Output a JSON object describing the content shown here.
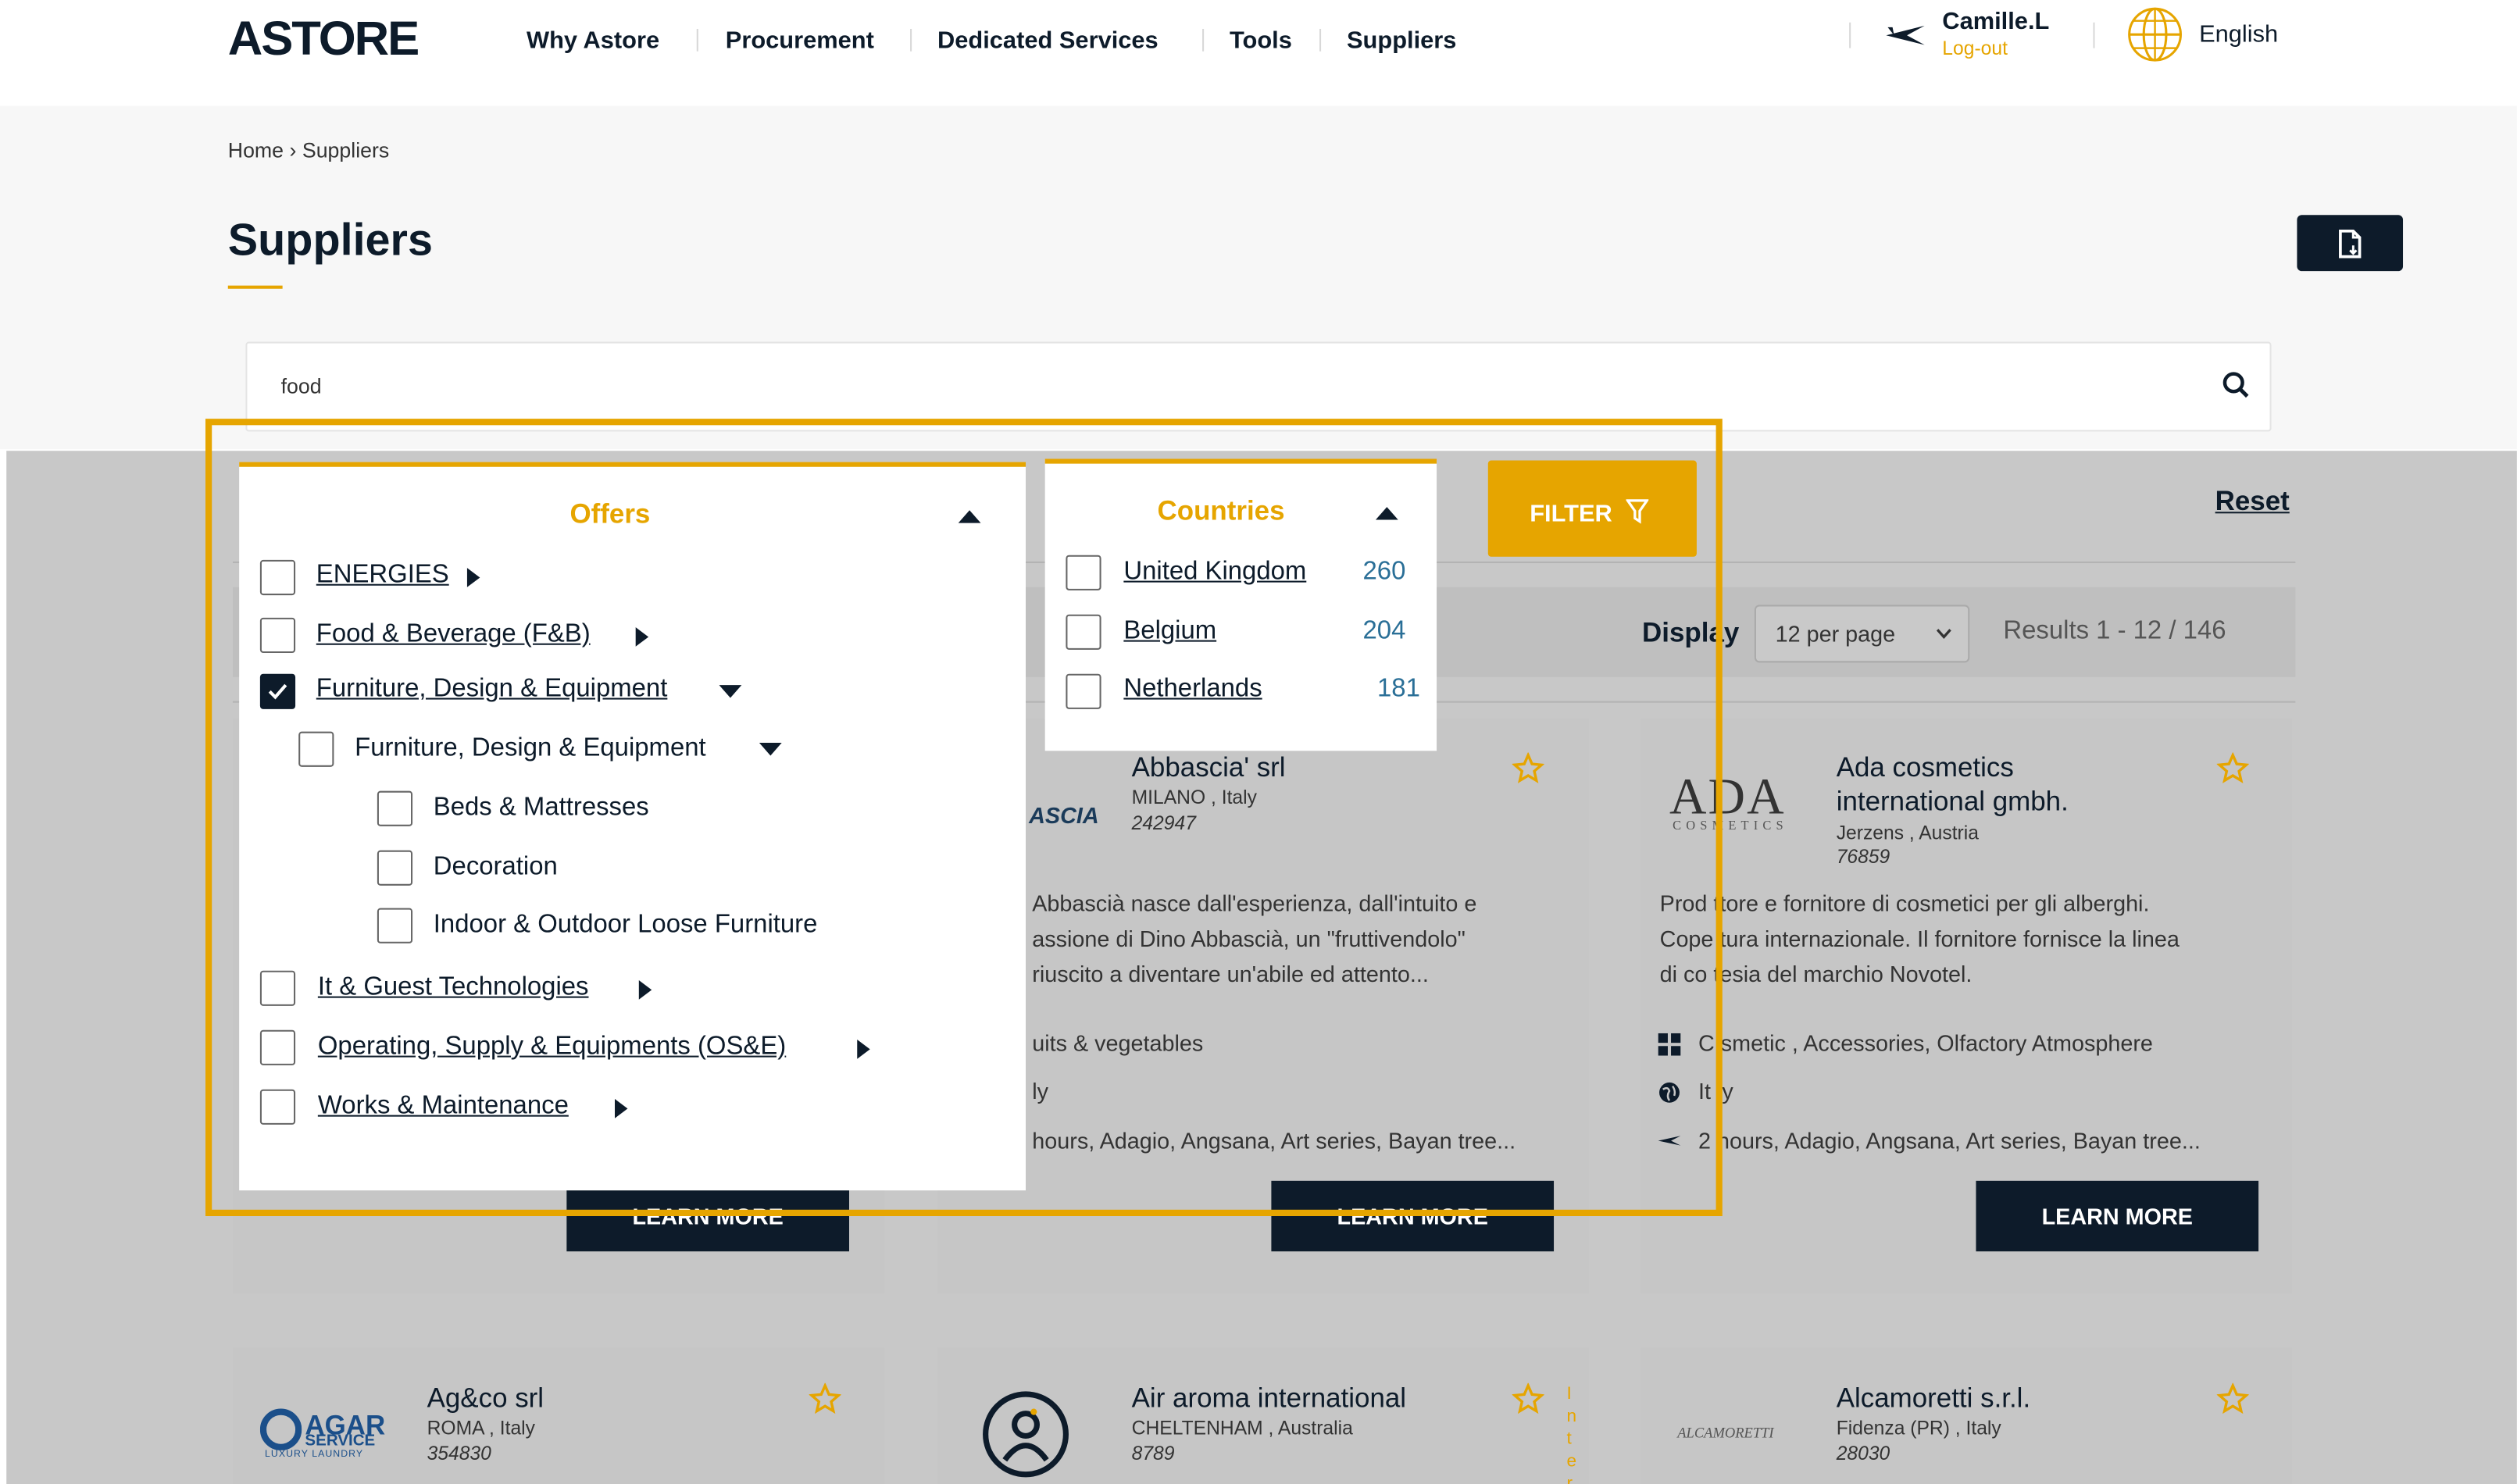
{
  "header": {
    "logo": "ASTORE",
    "nav": [
      "Why Astore",
      "Procurement",
      "Dedicated Services",
      "Tools",
      "Suppliers"
    ],
    "user_name": "Camille.L",
    "logout": "Log-out",
    "language": "English"
  },
  "breadcrumb": {
    "home": "Home",
    "sep": "›",
    "current": "Suppliers"
  },
  "page_title": "Suppliers",
  "search": {
    "value": "food"
  },
  "filters": {
    "offers": {
      "title": "Offers",
      "items": [
        {
          "label": "ENERGIES",
          "checked": false
        },
        {
          "label": "Food & Beverage (F&B)",
          "checked": false
        },
        {
          "label": "Furniture, Design & Equipment",
          "checked": true
        },
        {
          "label": "Furniture, Design & Equipment",
          "checked": false
        },
        {
          "label": "Beds & Mattresses",
          "checked": false
        },
        {
          "label": "Decoration",
          "checked": false
        },
        {
          "label": "Indoor & Outdoor Loose Furniture",
          "checked": false
        },
        {
          "label": "It & Guest Technologies",
          "checked": false
        },
        {
          "label": "Operating, Supply & Equipments (OS&E)",
          "checked": false
        },
        {
          "label": "Works & Maintenance",
          "checked": false
        }
      ]
    },
    "countries": {
      "title": "Countries",
      "items": [
        {
          "label": "United Kingdom",
          "count": "260"
        },
        {
          "label": "Belgium",
          "count": "204"
        },
        {
          "label": "Netherlands",
          "count": "181"
        }
      ]
    },
    "filter_button": "FILTER",
    "reset": "Reset"
  },
  "results_bar": {
    "display_label": "Display",
    "per_page": "12 per page",
    "results": "Results 1 - 12 / 146"
  },
  "cards": [
    {
      "name": "Abbascia' srl",
      "location": "MILANO , Italy",
      "id": "242947",
      "logo_text": "ASCIA",
      "description": [
        "Abbascià nasce dall'esperienza, dall'intuito e",
        "assione di Dino Abbascià, un \"fruttivendolo\"",
        "riuscito a diventare un'abile ed attento..."
      ],
      "category": "uits & vegetables",
      "country": "ly",
      "brands": "hours, Adagio, Angsana, Art series, Bayan tree...",
      "button": "LEARN MORE"
    },
    {
      "name": "Ada cosmetics",
      "name2": "international gmbh.",
      "location": "Jerzens , Austria",
      "id": "76859",
      "logo_text": "ADA",
      "logo_sub": "COSMETICS",
      "description": [
        "Prod ttore e fornitore di cosmetici per gli alberghi.",
        "Cope tura internazionale. Il fornitore fornisce la linea",
        "di co tesia del marchio Novotel."
      ],
      "category": "C smetic , Accessories, Olfactory Atmosphere",
      "country": "It ly",
      "brands": "2  hours, Adagio, Angsana, Art series, Bayan tree...",
      "button": "LEARN MORE"
    },
    {
      "name": "Ag&co srl",
      "location": "ROMA , Italy",
      "id": "354830",
      "logo_text": "AGAR",
      "logo_sub": "SERVICE",
      "logo_sub2": "LUXURY LAUNDRY"
    },
    {
      "name": "Air aroma international",
      "location": "CHELTENHAM , Australia",
      "id": "8789",
      "side_text": "Inter"
    },
    {
      "name": "Alcamoretti s.r.l.",
      "location": "Fidenza (PR) , Italy",
      "id": "28030",
      "logo_text": "ALCAMORETTI"
    }
  ],
  "hidden_button": "LEARN MORE",
  "colors": {
    "accent": "#e6a500",
    "navy": "#0d1b2a",
    "dim": "#c8c8c8"
  }
}
